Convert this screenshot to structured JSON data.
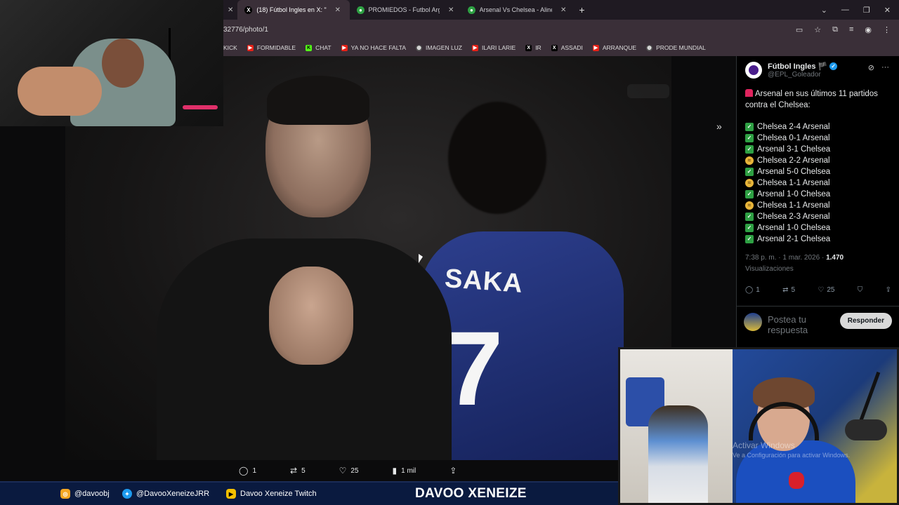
{
  "browser": {
    "tabs": [
      {
        "label": "(18) Fútbol Ingles      en X: \"",
        "active": true
      },
      {
        "label": "PROMIEDOS - Futbol Argentino",
        "active": false
      },
      {
        "label": "Arsenal Vs Chelsea - Alineacio",
        "active": false
      }
    ],
    "url": "32776/photo/1",
    "bookmarks": [
      {
        "label": "KICK",
        "icon": "kick-icon"
      },
      {
        "label": "FORMIDABLE",
        "icon": "youtube-icon"
      },
      {
        "label": "CHAT",
        "icon": "kick-icon"
      },
      {
        "label": "YA NO HACE FALTA",
        "icon": "youtube-icon"
      },
      {
        "label": "IMAGEN LUZ",
        "icon": "globe-icon"
      },
      {
        "label": "ILARI LARIE",
        "icon": "youtube-icon"
      },
      {
        "label": "IR",
        "icon": "x-icon"
      },
      {
        "label": "ASSADI",
        "icon": "x-icon"
      },
      {
        "label": "ARRANQUE",
        "icon": "youtube-icon"
      },
      {
        "label": "PRODE MUNDIAL",
        "icon": "globe-icon"
      }
    ]
  },
  "photo": {
    "jersey_name": "SAKA",
    "jersey_number": "7",
    "actions": {
      "replies": "1",
      "reposts": "5",
      "likes": "25",
      "views": "1 mil"
    }
  },
  "tweet": {
    "name": "Fútbol Ingles",
    "flag": "🏴",
    "handle": "@EPL_Goleador",
    "intro": "Arsenal en sus últimos 11 partidos contra el Chelsea:",
    "results": [
      {
        "text": "Chelsea 2-4 Arsenal",
        "outcome": "win"
      },
      {
        "text": "Chelsea 0-1 Arsenal",
        "outcome": "win"
      },
      {
        "text": "Arsenal 3-1 Chelsea",
        "outcome": "win"
      },
      {
        "text": "Chelsea 2-2 Arsenal",
        "outcome": "draw"
      },
      {
        "text": "Arsenal 5-0 Chelsea",
        "outcome": "win"
      },
      {
        "text": "Chelsea 1-1 Arsenal",
        "outcome": "draw"
      },
      {
        "text": "Arsenal 1-0 Chelsea",
        "outcome": "win"
      },
      {
        "text": "Chelsea 1-1 Arsenal",
        "outcome": "draw"
      },
      {
        "text": "Chelsea 2-3 Arsenal",
        "outcome": "win"
      },
      {
        "text": "Arsenal 1-0 Chelsea",
        "outcome": "win"
      },
      {
        "text": "Arsenal 2-1 Chelsea",
        "outcome": "win"
      }
    ],
    "time": "7:38 p. m. · 1 mar. 2026 · ",
    "views_count": "1.470",
    "views_label": "Visualizaciones",
    "actions": {
      "replies": "1",
      "reposts": "5",
      "likes": "25"
    },
    "reply_placeholder": "Postea tu respuesta",
    "reply_button": "Responder"
  },
  "stream": {
    "watermark_line1": "Activar Windows",
    "watermark_line2": "Ve a Configuración para activar Windows.",
    "socials": {
      "instagram": "@davoobj",
      "twitter": "@DavooXeneizeJRR",
      "youtube": "Davoo Xeneize Twitch"
    },
    "brand": "DAVOO XENEIZE"
  },
  "colors": {
    "accent_blue": "#1d9bf0",
    "win_green": "#2ea043",
    "draw_yellow": "#e8b53a",
    "footer_navy": "#0a1a3f"
  }
}
